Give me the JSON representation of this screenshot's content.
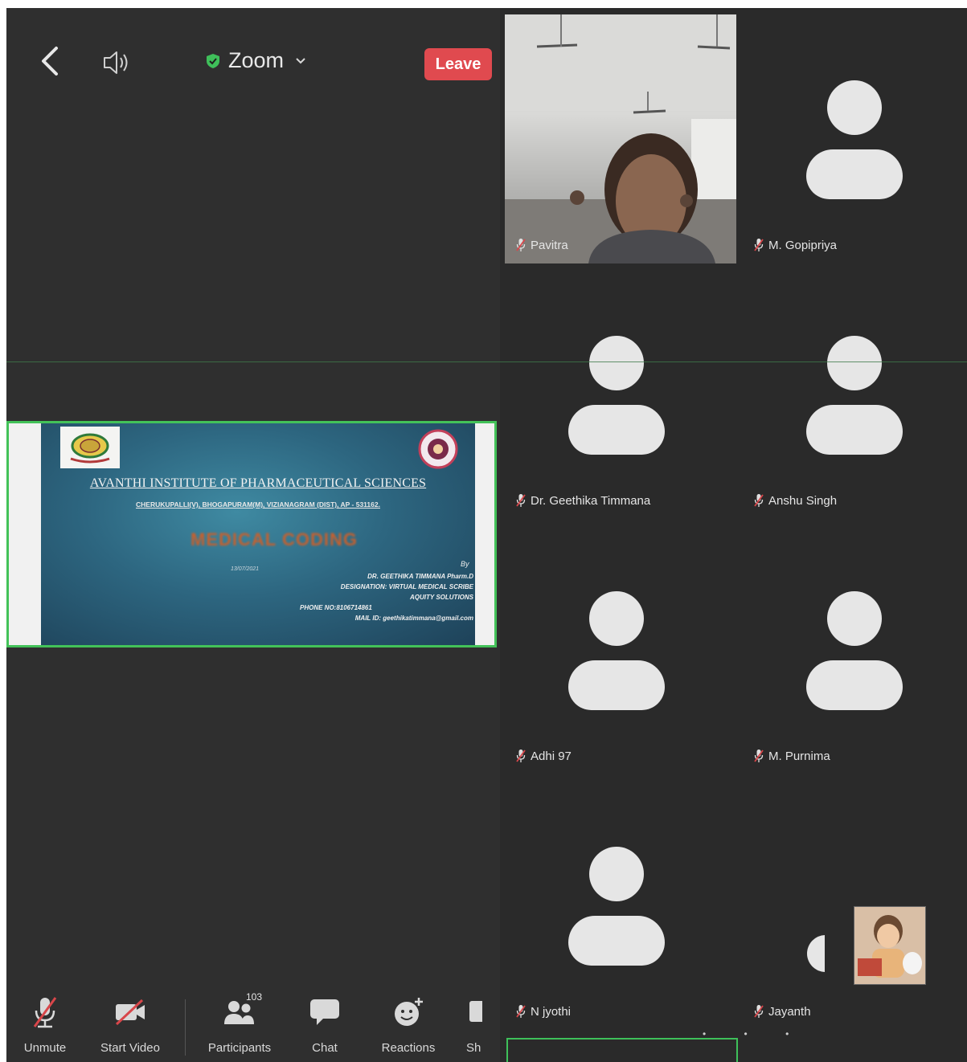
{
  "header": {
    "meeting_title": "Zoom",
    "leave_label": "Leave"
  },
  "slide": {
    "title": "AVANTHI INSTITUTE OF PHARMACEUTICAL SCIENCES",
    "address": "CHERUKUPALLI(V), BHOGAPURAM(M), VIZIANAGRAM (DIST), AP - 531162.",
    "topic": "MEDICAL CODING",
    "by": "By",
    "presenter": "DR. GEETHIKA TIMMANA Pharm.D",
    "designation": "DESIGNATION: VIRTUAL MEDICAL SCRIBE",
    "company": "AQUITY SOLUTIONS",
    "phone": "PHONE NO:8106714861",
    "mail": "MAIL ID: geethikatimmana@gmail.com",
    "date": "13/07/2021"
  },
  "participants": [
    {
      "name": "Pavitra",
      "video": true
    },
    {
      "name": "M. Gopipriya",
      "video": false
    },
    {
      "name": "Dr. Geethika Timmana",
      "video": false
    },
    {
      "name": "Anshu Singh",
      "video": false
    },
    {
      "name": "Adhi 97",
      "video": false
    },
    {
      "name": "M. Purnima",
      "video": false
    },
    {
      "name": "N jyothi",
      "video": false
    },
    {
      "name": "Jayanth",
      "video": false
    }
  ],
  "toolbar": {
    "unmute": "Unmute",
    "start_video": "Start Video",
    "participants": "Participants",
    "participant_count": "103",
    "chat": "Chat",
    "reactions": "Reactions",
    "share": "Sh"
  },
  "colors": {
    "leave_button": "#e04a4f",
    "active_speaker": "#43c259",
    "secure_shield": "#3fbf5a",
    "background": "#2c2c2c"
  }
}
